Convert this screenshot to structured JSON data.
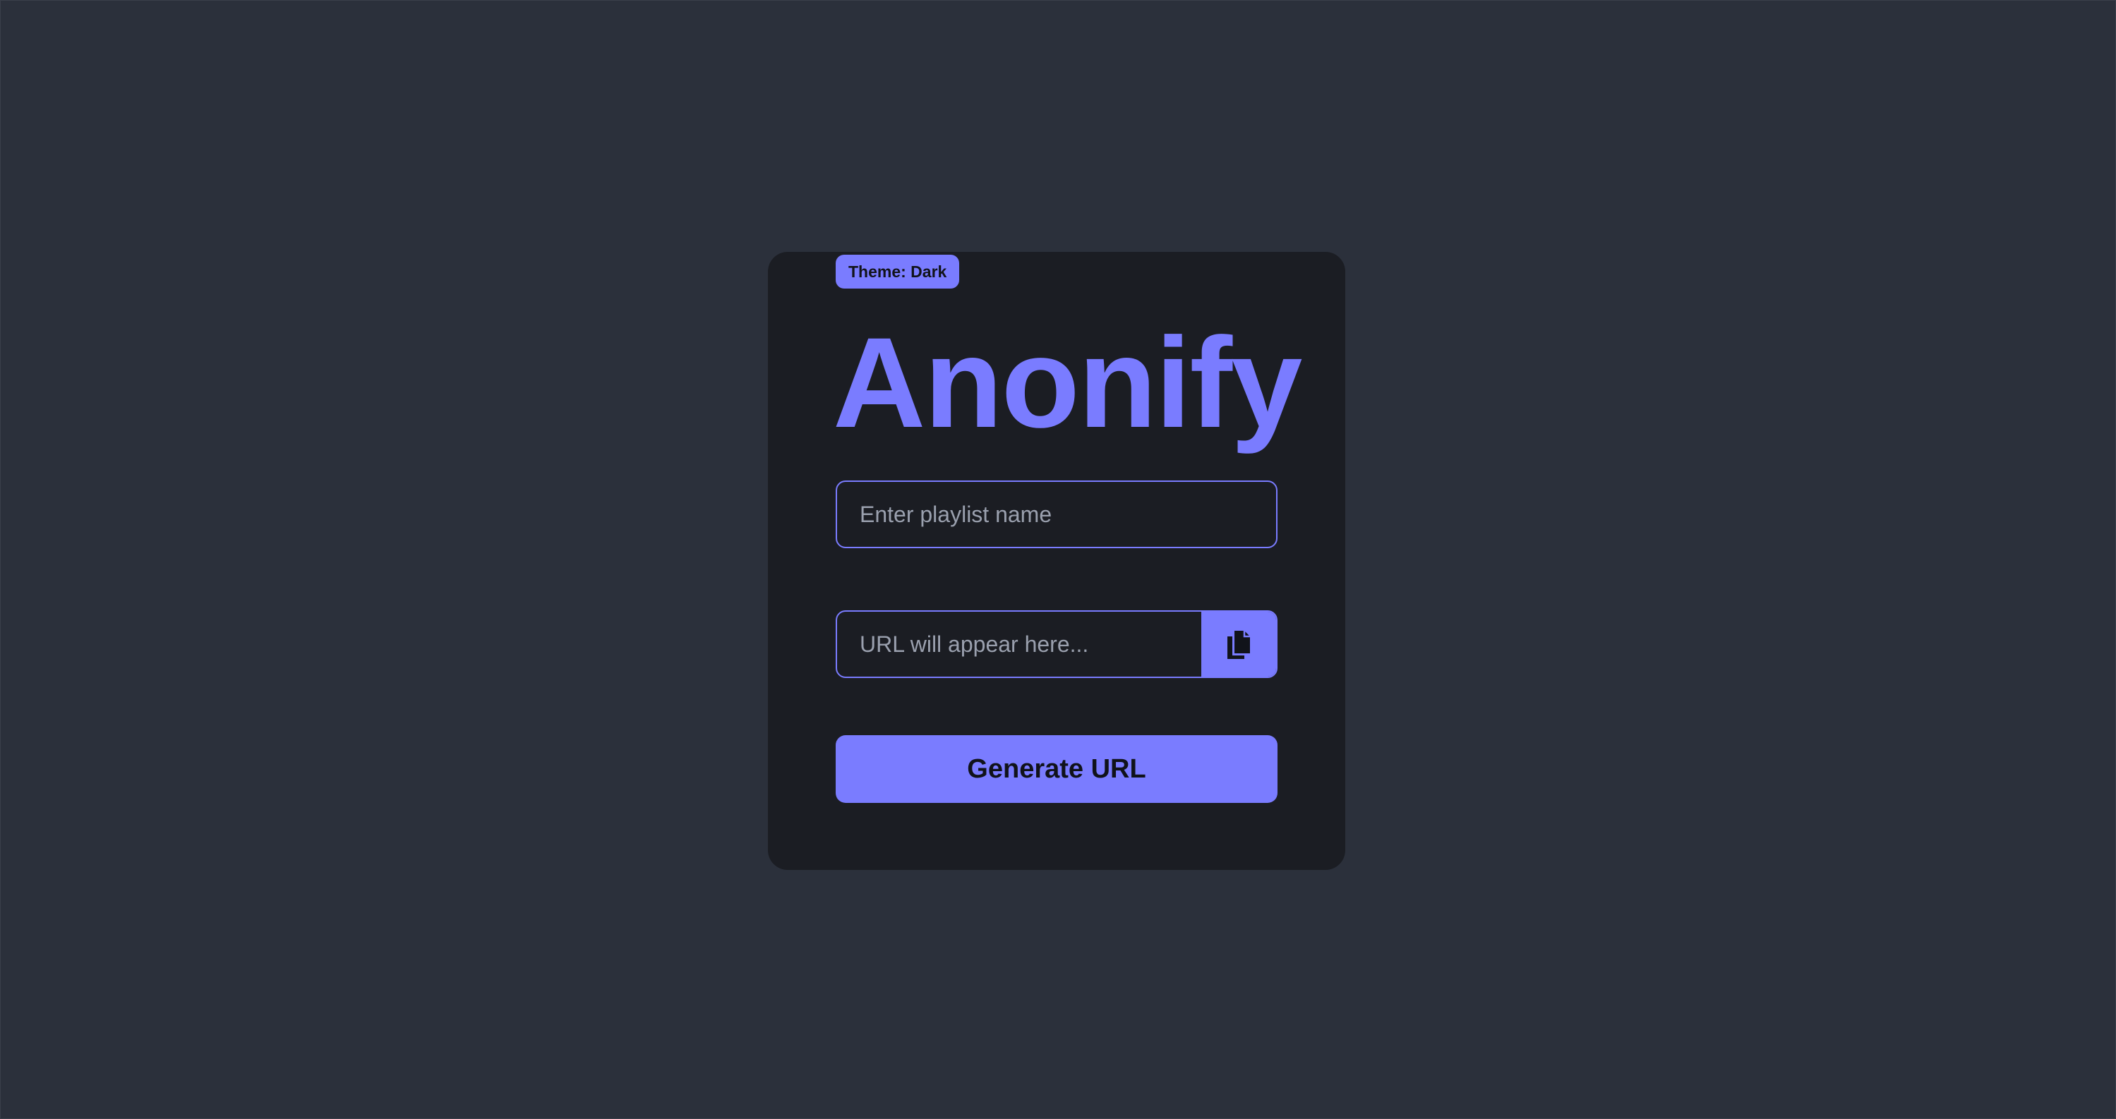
{
  "theme_badge": {
    "label": "Theme: Dark"
  },
  "app": {
    "title": "Anonify"
  },
  "playlist_input": {
    "placeholder": "Enter playlist name",
    "value": ""
  },
  "url_output": {
    "placeholder": "URL will appear here...",
    "value": ""
  },
  "copy_button": {
    "icon": "copy-icon"
  },
  "generate_button": {
    "label": "Generate URL"
  },
  "colors": {
    "page_background": "#2b303b",
    "card_background": "#1b1d23",
    "accent": "#7a7cff",
    "placeholder_text": "#9aa0ae",
    "button_text": "#10121a"
  }
}
